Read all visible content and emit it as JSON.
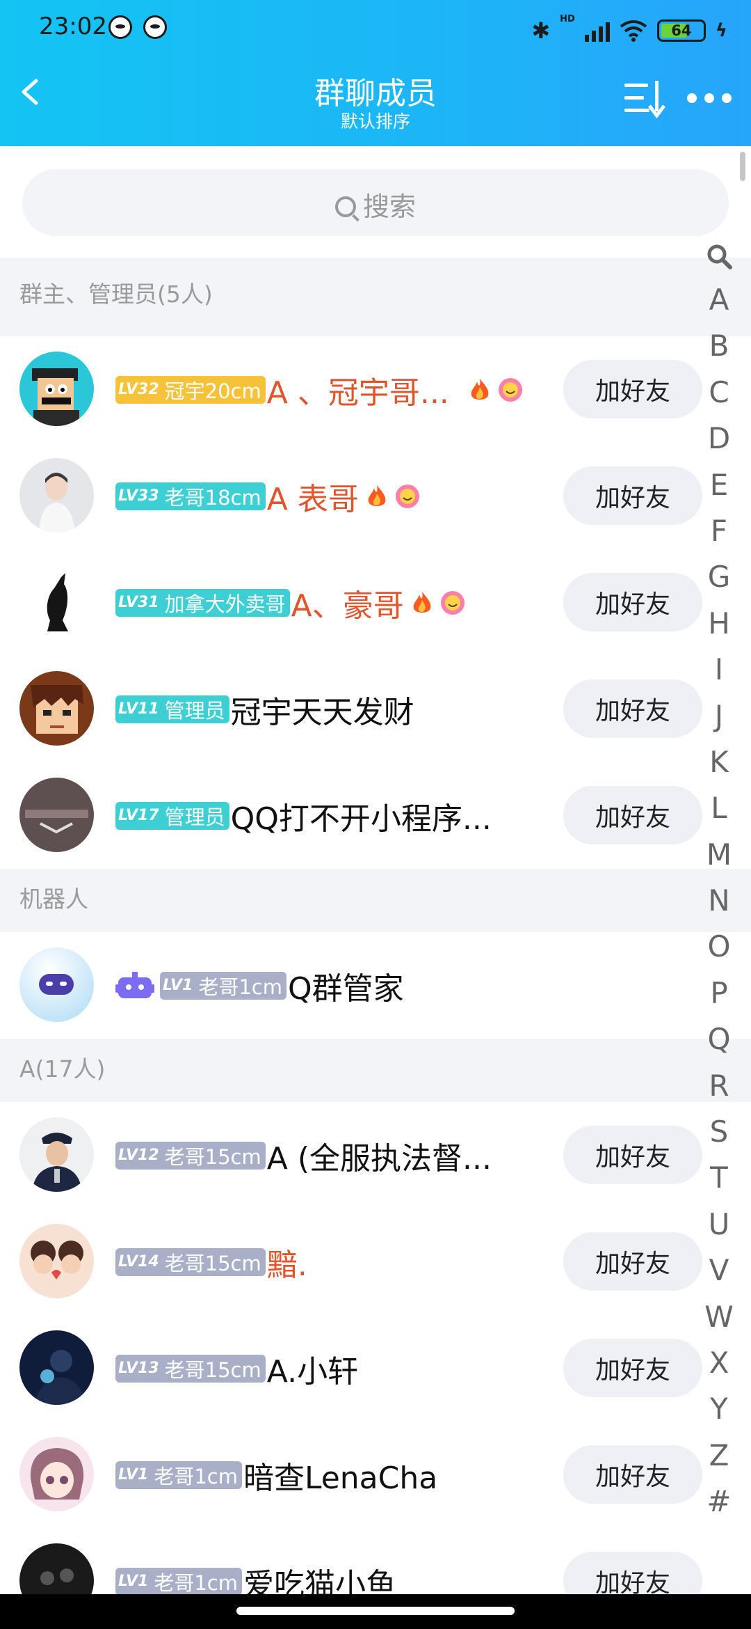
{
  "status": {
    "time": "23:02",
    "battery": "64",
    "network": "HD"
  },
  "header": {
    "title": "群聊成员",
    "subtitle": "默认排序"
  },
  "search": {
    "placeholder": "搜索"
  },
  "sections": {
    "admins": "群主、管理员(5人)",
    "robots": "机器人",
    "a": "A(17人)"
  },
  "add_label": "加好友",
  "members": [
    {
      "lv": "LV32",
      "title": "冠宇20cm",
      "name": "A 、冠宇哥...",
      "color": "red",
      "badge": "gold"
    },
    {
      "lv": "LV33",
      "title": "老哥18cm",
      "name": "A 表哥",
      "color": "red",
      "badge": "teal"
    },
    {
      "lv": "LV31",
      "title": "加拿大外卖哥",
      "name": "A、豪哥",
      "color": "red",
      "badge": "teal"
    },
    {
      "lv": "LV11",
      "title": "管理员",
      "name": "冠宇天天发财",
      "color": "black",
      "badge": "teal"
    },
    {
      "lv": "LV17",
      "title": "管理员",
      "name": "QQ打不开小程序...",
      "color": "black",
      "badge": "teal"
    },
    {
      "lv": "LV1",
      "title": "老哥1cm",
      "name": "Q群管家",
      "color": "black",
      "badge": "gray"
    },
    {
      "lv": "LV12",
      "title": "老哥15cm",
      "name": "A (全服执法督...",
      "color": "black",
      "badge": "gray"
    },
    {
      "lv": "LV14",
      "title": "老哥15cm",
      "name": "黯.",
      "color": "red",
      "badge": "gray"
    },
    {
      "lv": "LV13",
      "title": "老哥15cm",
      "name": "A.小轩",
      "color": "black",
      "badge": "gray"
    },
    {
      "lv": "LV1",
      "title": "老哥1cm",
      "name": "暗查LenaCha",
      "color": "black",
      "badge": "gray"
    },
    {
      "lv": "LV1",
      "title": "老哥1cm",
      "name": "爱吃猫小鱼",
      "color": "black",
      "badge": "gray"
    }
  ],
  "index_letters": [
    "A",
    "B",
    "C",
    "D",
    "E",
    "F",
    "G",
    "H",
    "I",
    "J",
    "K",
    "L",
    "M",
    "N",
    "O",
    "P",
    "Q",
    "R",
    "S",
    "T",
    "U",
    "V",
    "W",
    "X",
    "Y",
    "Z",
    "#"
  ],
  "colors": {
    "accent": "#1cb6f7",
    "name_red": "#e0552c",
    "badge_gold": "#f6c23a",
    "badge_teal": "#3dcfd3",
    "badge_gray": "#a8afc6"
  }
}
